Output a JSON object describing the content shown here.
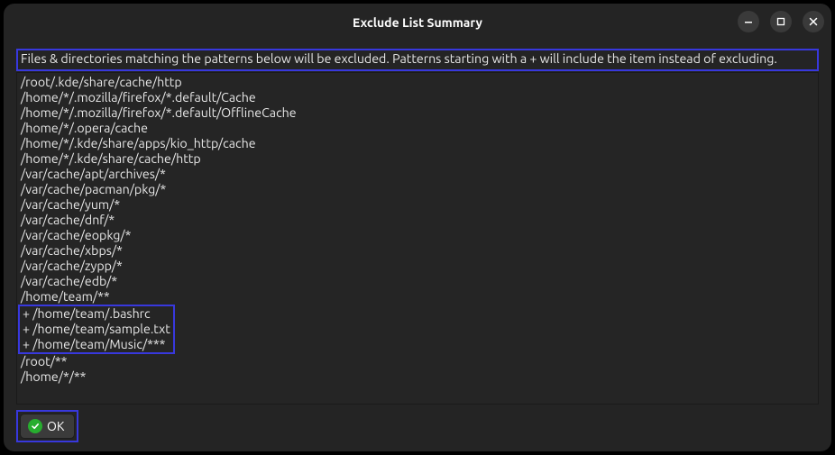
{
  "window": {
    "title": "Exclude List Summary"
  },
  "description": "Files & directories matching the patterns below will be excluded. Patterns starting with a + will include the item instead of excluding.",
  "patterns_before": [
    "/root/.kde/share/cache/http",
    "/home/*/.mozilla/firefox/*.default/Cache",
    "/home/*/.mozilla/firefox/*.default/OfflineCache",
    "/home/*/.opera/cache",
    "/home/*/.kde/share/apps/kio_http/cache",
    "/home/*/.kde/share/cache/http",
    "/var/cache/apt/archives/*",
    "/var/cache/pacman/pkg/*",
    "/var/cache/yum/*",
    "/var/cache/dnf/*",
    "/var/cache/eopkg/*",
    "/var/cache/xbps/*",
    "/var/cache/zypp/*",
    "/var/cache/edb/*",
    "/home/team/**"
  ],
  "patterns_include": [
    "+ /home/team/.bashrc",
    "+ /home/team/sample.txt",
    "+ /home/team/Music/***"
  ],
  "patterns_after": [
    "/root/**",
    "/home/*/**"
  ],
  "buttons": {
    "ok": "OK"
  }
}
